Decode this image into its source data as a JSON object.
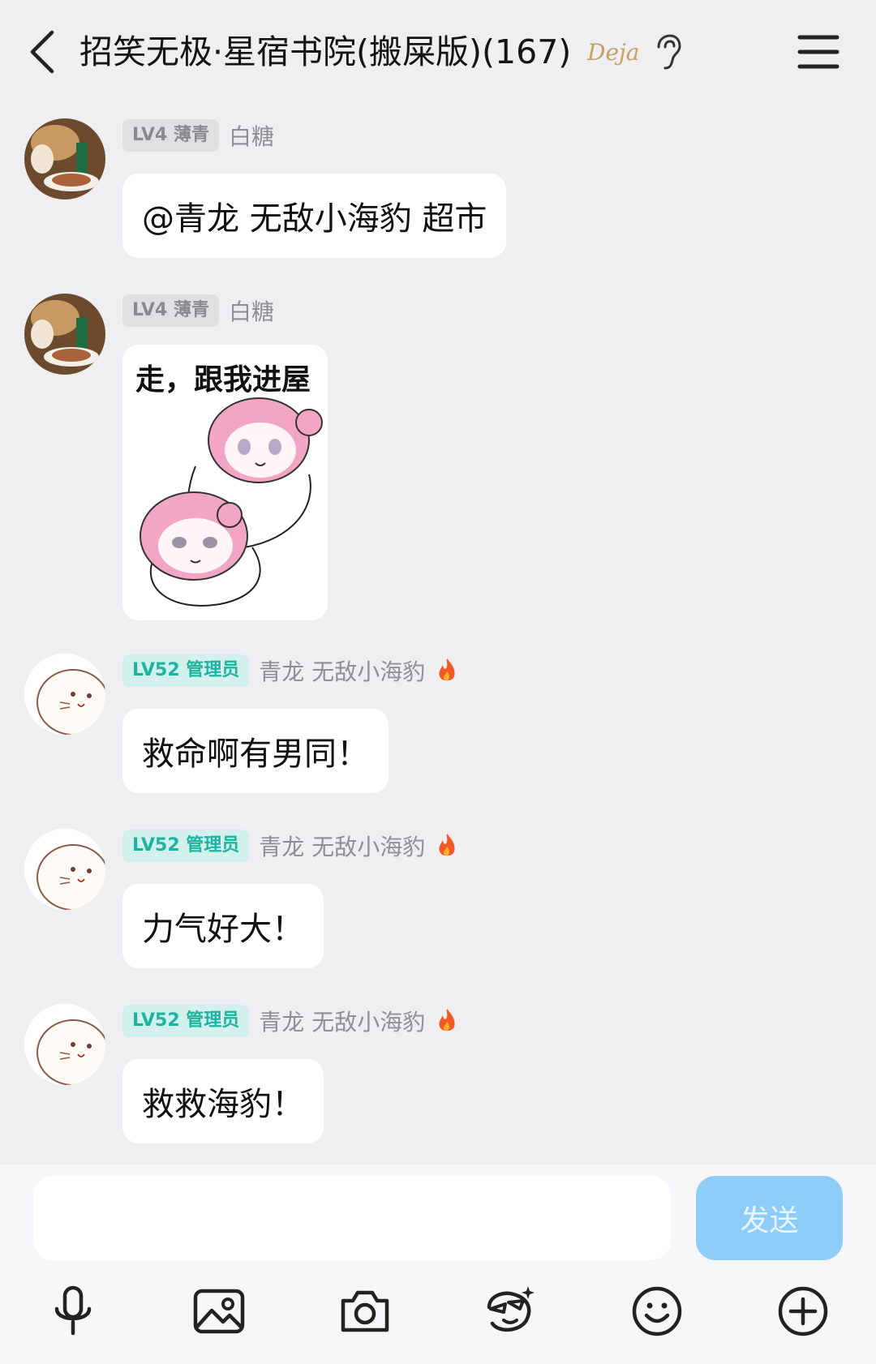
{
  "header": {
    "title": "招笑无极·星宿书院(搬屎版)(167)",
    "deja_logo": "Deja"
  },
  "messages": [
    {
      "badge": "LV4 薄青",
      "sender": "白糖",
      "text": "@青龙 无敌小海豹 超市"
    },
    {
      "badge": "LV4 薄青",
      "sender": "白糖",
      "sticker_caption": "走，跟我进屋"
    },
    {
      "badge": "LV52 管理员",
      "sender": "青龙 无敌小海豹",
      "text": "救命啊有男同！"
    },
    {
      "badge": "LV52 管理员",
      "sender": "青龙 无敌小海豹",
      "text": "力气好大！"
    },
    {
      "badge": "LV52 管理员",
      "sender": "青龙 无敌小海豹",
      "text": "救救海豹！"
    }
  ],
  "composer": {
    "placeholder": "",
    "send_label": "发送"
  },
  "toolbar": [
    "microphone-icon",
    "image-icon",
    "camera-icon",
    "sticker-icon",
    "emoji-icon",
    "plus-icon"
  ],
  "colors": {
    "background": "#efeff1",
    "send_button": "#8ecdf7",
    "admin_badge": "#1fb4a2",
    "lv4_badge": "#8a8a8f"
  }
}
